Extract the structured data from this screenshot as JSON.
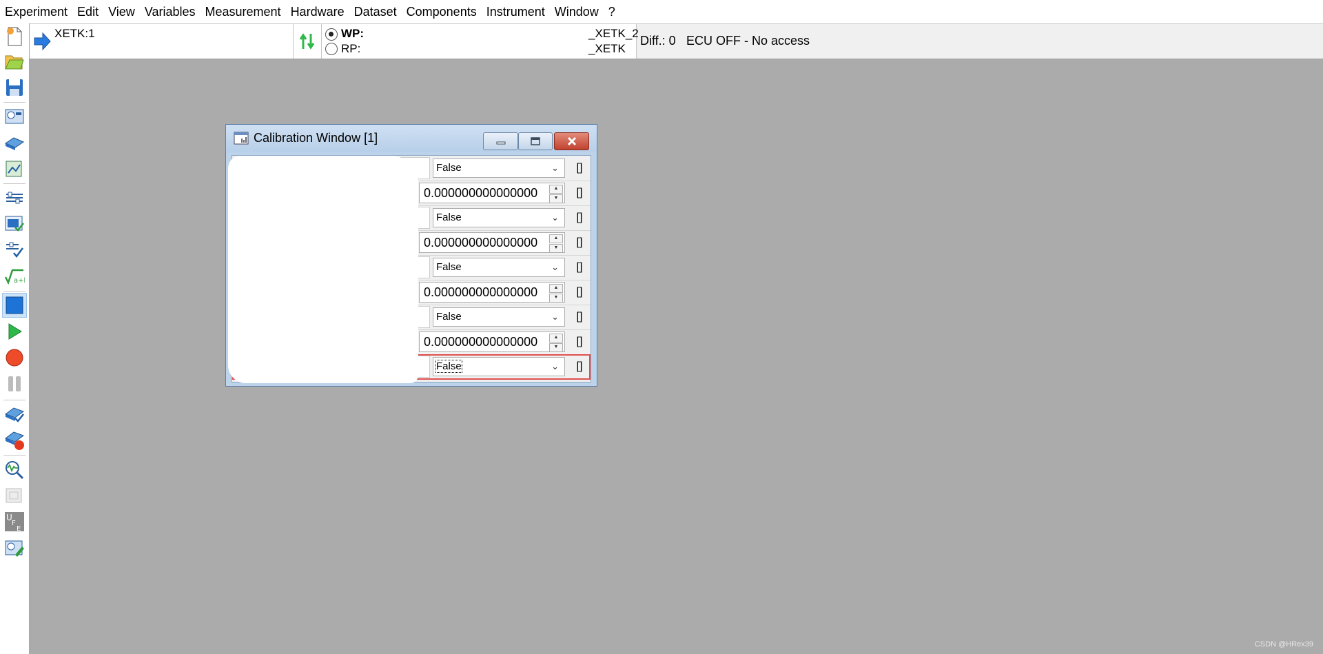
{
  "menu": [
    "Experiment",
    "Edit",
    "View",
    "Variables",
    "Measurement",
    "Hardware",
    "Dataset",
    "Components",
    "Instrument",
    "Window",
    "?"
  ],
  "toolbar": {
    "icons": [
      "new-experiment-icon",
      "open-folder-icon",
      "save-icon",
      "measure-config-icon",
      "hardware-config-icon",
      "dataset-manager-icon",
      "variable-selection-icon",
      "calibration-editor-icon",
      "variable-check-icon",
      "formula-icon",
      "calibration-window-icon",
      "start-measurement-icon",
      "record-icon",
      "pause-icon",
      "workspace-check-icon",
      "workspace-record-icon",
      "oscilloscope-icon",
      "disabled-window-icon",
      "ufe-icon",
      "measure-edit-icon"
    ]
  },
  "infobar": {
    "device": "XETK:1",
    "wp_label": "WP:",
    "rp_label": "RP:",
    "wp_ref": "_XETK_2",
    "rp_ref": "_XETK",
    "diff": "Diff.: 0",
    "ecu_status": "ECU OFF - No access",
    "wp_selected": true
  },
  "calibration_window": {
    "title": "Calibration Window [1]",
    "rows": [
      {
        "kind": "combo",
        "value": "False",
        "bracket": "[]"
      },
      {
        "kind": "spin",
        "value": "0.000000000000000",
        "bracket": "[]"
      },
      {
        "kind": "combo",
        "value": "False",
        "bracket": "[]"
      },
      {
        "kind": "spin",
        "value": "0.000000000000000",
        "bracket": "[]"
      },
      {
        "kind": "combo",
        "value": "False",
        "bracket": "[]"
      },
      {
        "kind": "spin",
        "value": "0.000000000000000",
        "bracket": "[]"
      },
      {
        "kind": "combo",
        "value": "False",
        "bracket": "[]"
      },
      {
        "kind": "spin",
        "value": "0.000000000000000",
        "bracket": "[]"
      },
      {
        "kind": "combo",
        "value": "False",
        "bracket": "[]",
        "selected": true
      }
    ]
  },
  "watermark": "CSDN @HRex39",
  "colors": {
    "workspace": "#ababab",
    "accent": "#1e74d6",
    "selection": "#e05050"
  }
}
